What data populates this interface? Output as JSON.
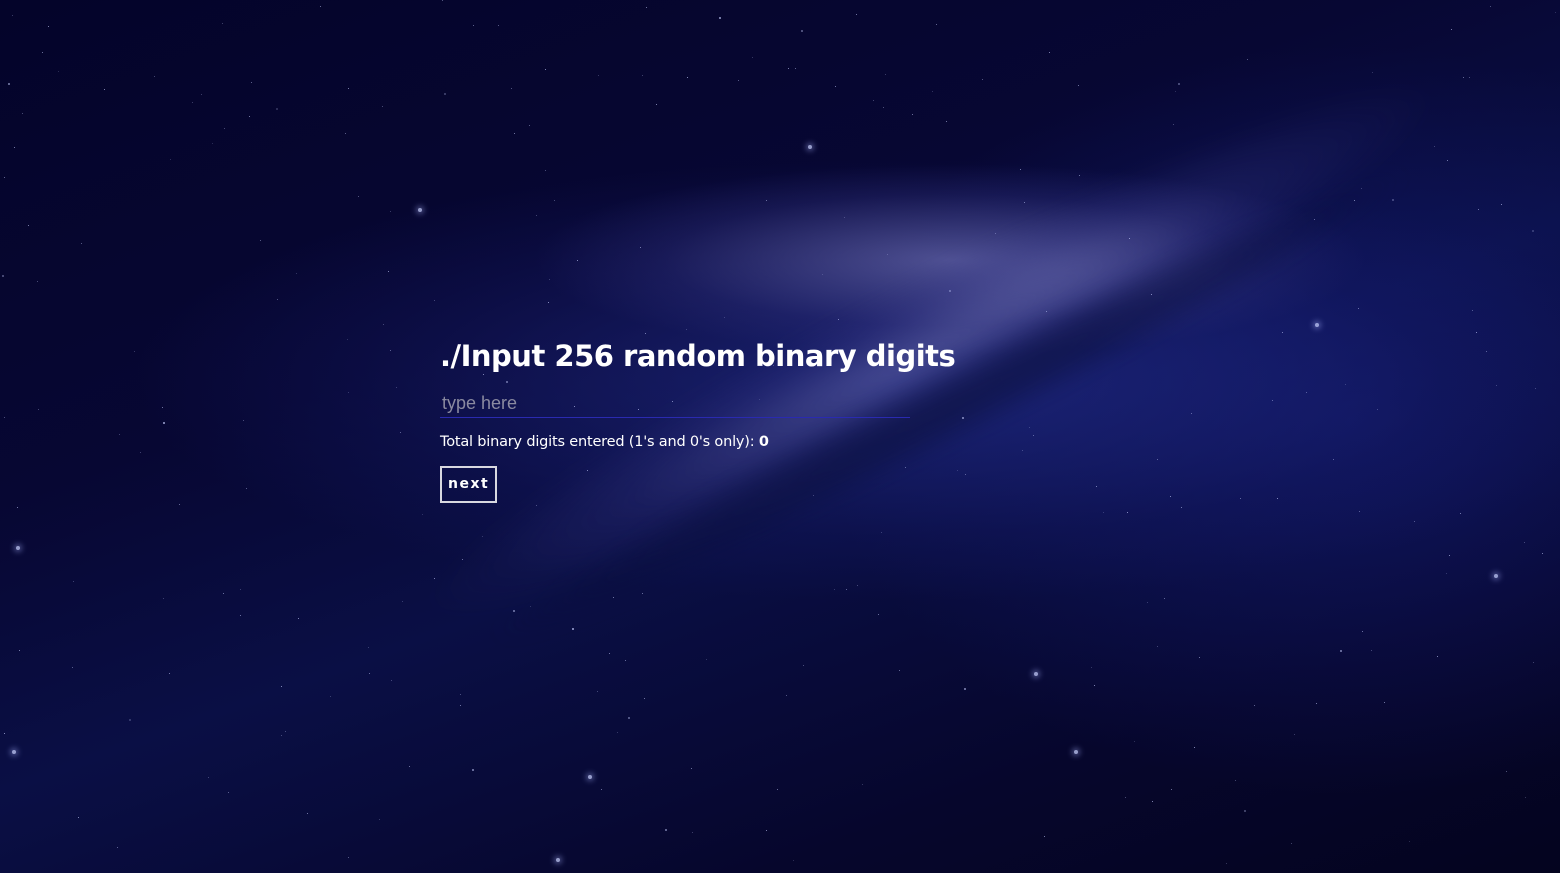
{
  "page": {
    "title": "./Input 256 random binary digits"
  },
  "input": {
    "value": "",
    "placeholder": "type here"
  },
  "counter": {
    "label": "Total binary digits entered (1's and 0's only):",
    "count": "0"
  },
  "actions": {
    "next_label": "next"
  },
  "colors": {
    "background": "#05052a",
    "text": "#ffffff",
    "input_underline": "#2a2ab0",
    "button_border": "#d8d8e0"
  }
}
